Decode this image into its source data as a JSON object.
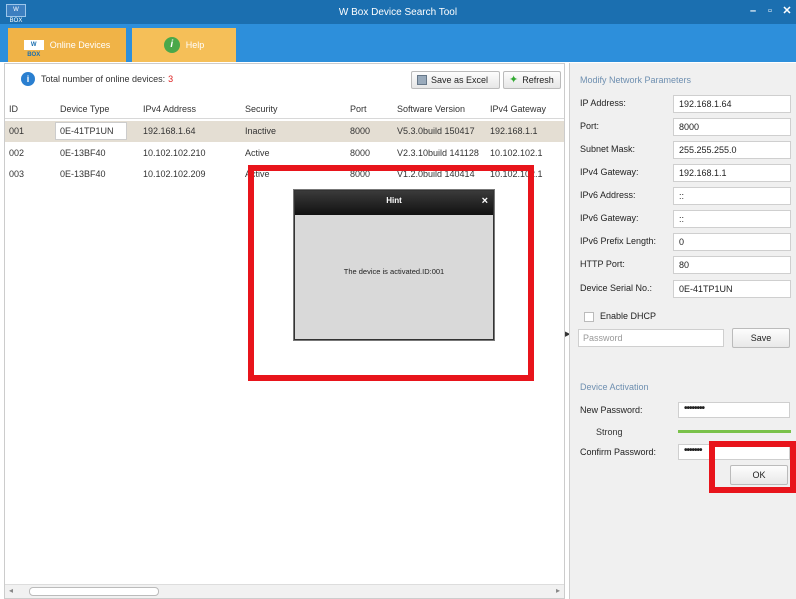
{
  "window": {
    "logo": "W BOX",
    "title": "W Box Device Search Tool",
    "minimize": "–",
    "maximize": "▫",
    "close": "✕"
  },
  "tabs": [
    {
      "label": "Online Devices",
      "logo": "W BOX"
    },
    {
      "label": "Help",
      "icon": "help-icon",
      "glyph": "i"
    }
  ],
  "summary": {
    "label": "Total number of online devices:",
    "count": "3"
  },
  "buttons": {
    "save_excel": "Save as Excel",
    "refresh": "Refresh"
  },
  "table": {
    "columns": [
      "ID",
      "Device Type",
      "IPv4 Address",
      "Security",
      "Port",
      "Software Version",
      "IPv4 Gateway"
    ],
    "rows": [
      {
        "id": "001",
        "type": "0E-41TP1UN",
        "ip": "192.168.1.64",
        "security": "Inactive",
        "port": "8000",
        "version": "V5.3.0build 150417",
        "gateway": "192.168.1.1"
      },
      {
        "id": "002",
        "type": "0E-13BF40",
        "ip": "10.102.102.210",
        "security": "Active",
        "port": "8000",
        "version": "V2.3.10build 141128",
        "gateway": "10.102.102.1"
      },
      {
        "id": "003",
        "type": "0E-13BF40",
        "ip": "10.102.102.209",
        "security": "Active",
        "port": "8000",
        "version": "V1.2.0build 140414",
        "gateway": "10.102.102.1"
      }
    ]
  },
  "network": {
    "title": "Modify Network Parameters",
    "fields": [
      {
        "label": "IP Address:",
        "value": "192.168.1.64"
      },
      {
        "label": "Port:",
        "value": "8000"
      },
      {
        "label": "Subnet Mask:",
        "value": "255.255.255.0"
      },
      {
        "label": "IPv4 Gateway:",
        "value": "192.168.1.1"
      },
      {
        "label": "IPv6 Address:",
        "value": "::"
      },
      {
        "label": "IPv6 Gateway:",
        "value": "::"
      },
      {
        "label": "IPv6 Prefix Length:",
        "value": "0"
      },
      {
        "label": "HTTP Port:",
        "value": "80"
      },
      {
        "label": "Device Serial No.:",
        "value": "0E-41TP1UN"
      }
    ],
    "dhcp_label": "Enable DHCP",
    "password_placeholder": "Password",
    "save_label": "Save"
  },
  "activation": {
    "title": "Device Activation",
    "new_password_label": "New Password:",
    "new_password_value": "••••••••",
    "strength": "Strong",
    "confirm_label": "Confirm Password:",
    "confirm_value": "•••••••",
    "ok_label": "OK"
  },
  "dialog": {
    "title": "Hint",
    "message": "The device is activated.ID:001",
    "close": "×"
  },
  "colors": {
    "titlebar": "#1b6fb0",
    "toolbar": "#2d8fdb",
    "tab": "#f0b347",
    "highlight": "#e8141b",
    "strength": "#7ac24a"
  }
}
